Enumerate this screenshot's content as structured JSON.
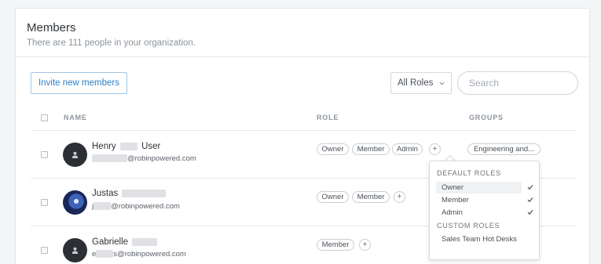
{
  "header": {
    "title": "Members",
    "subtitle": "There are 111 people in your organization."
  },
  "toolbar": {
    "invite_label": "Invite new members",
    "role_filter": "All Roles",
    "search_placeholder": "Search"
  },
  "table": {
    "columns": [
      "NAME",
      "ROLE",
      "GROUPS"
    ],
    "rows": [
      {
        "first_name": "Henry",
        "last_name": "User",
        "email_domain": "@robinpowered.com",
        "roles": [
          "Owner",
          "Member",
          "Admin"
        ],
        "group": "Engineering and..."
      },
      {
        "first_name": "Justas",
        "email_prefix": "j",
        "email_domain": "@robinpowered.com",
        "roles": [
          "Owner",
          "Member"
        ]
      },
      {
        "first_name": "Gabrielle",
        "email_prefix": "e",
        "email_domain": "s@robinpowered.com",
        "roles": [
          "Member"
        ]
      }
    ]
  },
  "role_dropdown": {
    "default_heading": "DEFAULT ROLES",
    "default_roles": [
      {
        "label": "Owner",
        "checked": true,
        "highlighted": true
      },
      {
        "label": "Member",
        "checked": true
      },
      {
        "label": "Admin",
        "checked": true
      }
    ],
    "custom_heading": "CUSTOM ROLES",
    "custom_roles": [
      {
        "label": "Sales Team Hot Desks",
        "checked": false
      }
    ]
  },
  "colors": {
    "accent": "#2f7fc4",
    "avatar_dark": "#2c3035",
    "divider": "#e6e8eb"
  },
  "icons": {
    "user_placeholder": "person-icon",
    "add": "plus-icon",
    "check": "check-icon",
    "chevron": "chevron-down-icon"
  }
}
